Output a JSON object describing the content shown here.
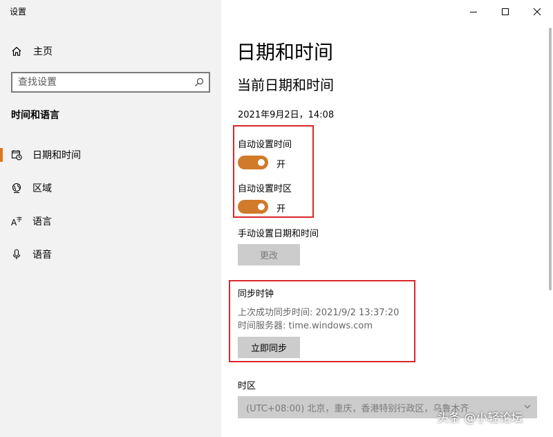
{
  "window": {
    "title": "设置"
  },
  "sidebar": {
    "home_label": "主页",
    "search_placeholder": "查找设置",
    "section_title": "时间和语言",
    "items": [
      {
        "label": "日期和时间",
        "icon": "date-time-icon",
        "selected": true
      },
      {
        "label": "区域",
        "icon": "globe-icon",
        "selected": false
      },
      {
        "label": "语言",
        "icon": "language-icon",
        "selected": false
      },
      {
        "label": "语音",
        "icon": "microphone-icon",
        "selected": false
      }
    ]
  },
  "main": {
    "page_title": "日期和时间",
    "subtitle": "当前日期和时间",
    "current_datetime": "2021年9月2日，14:08",
    "auto_time": {
      "label": "自动设置时间",
      "state": "开",
      "on": true
    },
    "auto_timezone": {
      "label": "自动设置时区",
      "state": "开",
      "on": true
    },
    "manual": {
      "label": "手动设置日期和时间",
      "button": "更改"
    },
    "sync": {
      "title": "同步时钟",
      "last_sync": "上次成功同步时间: 2021/9/2 13:37:20",
      "server": "时间服务器: time.windows.com",
      "button": "立即同步"
    },
    "timezone": {
      "label": "时区",
      "value": "(UTC+08:00) 北京，重庆，香港特别行政区，乌鲁木齐"
    }
  },
  "watermark": "头条 @小轻论坛",
  "colors": {
    "accent": "#e0761b",
    "toggle_on": "#d07a2a",
    "highlight_box": "#d9262a",
    "sidebar_bg": "#f2f2f2"
  }
}
